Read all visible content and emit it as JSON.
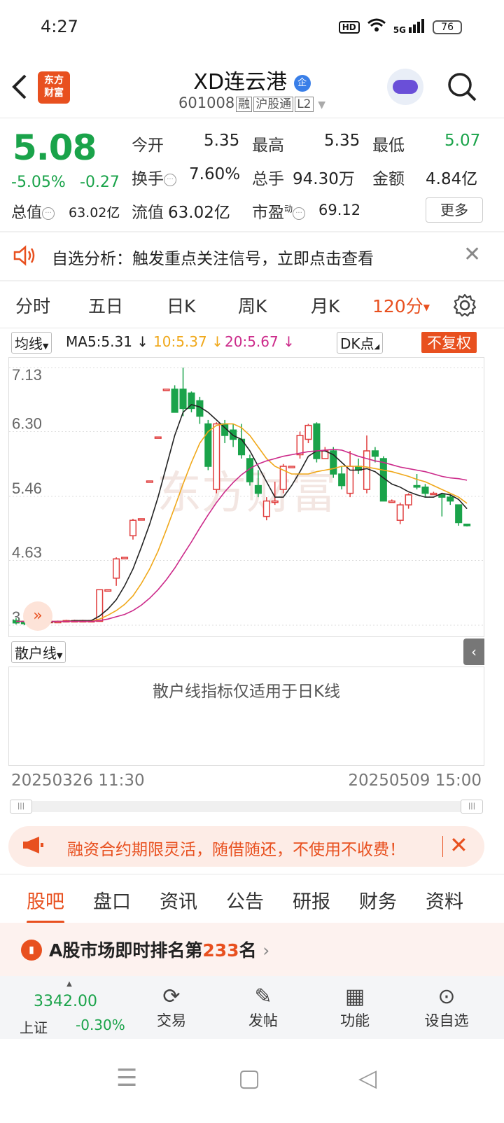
{
  "status": {
    "time": "4:27",
    "hd": "HD",
    "net": "5G",
    "battery": "76"
  },
  "header": {
    "logo_line1": "东方",
    "logo_line2": "财富",
    "stock_name": "XD连云港",
    "name_badge": "企",
    "code": "601008",
    "tags": [
      "融",
      "沪股通",
      "L2"
    ]
  },
  "quote": {
    "price": "5.08",
    "change_pct": "-5.05%",
    "change": "-0.27",
    "open_label": "今开",
    "open": "5.35",
    "high_label": "最高",
    "high": "5.35",
    "low_label": "最低",
    "low": "5.07",
    "turnover_label": "换手",
    "turnover": "7.60%",
    "volume_label": "总手",
    "volume": "94.30万",
    "amount_label": "金额",
    "amount": "4.84亿",
    "mktcap_label": "总值",
    "mktcap": "63.02亿",
    "float_label": "流值",
    "float": "63.02亿",
    "pe_label": "市盈",
    "pe_sup": "动",
    "pe": "69.12",
    "more": "更多"
  },
  "notice": {
    "text": "自选分析：触发重点关注信号，立即点击查看"
  },
  "period_tabs": [
    "分时",
    "五日",
    "日K",
    "周K",
    "月K",
    "120分"
  ],
  "indicator": {
    "ma_select": "均线",
    "ma5": "MA5:5.31",
    "ma10": "10:5.37",
    "ma20": "20:5.67",
    "dk": "DK点",
    "adjust": "不复权"
  },
  "chart_data": {
    "type": "candlestick",
    "y_ticks": [
      "7.13",
      "6.30",
      "5.46",
      "4.63",
      "3.79"
    ],
    "ylim": [
      3.79,
      7.13
    ],
    "watermark": "东方财富",
    "candles": [
      {
        "o": 3.85,
        "c": 3.82,
        "h": 3.88,
        "l": 3.8
      },
      {
        "o": 3.83,
        "c": 3.81,
        "h": 3.86,
        "l": 3.79
      },
      {
        "o": 3.8,
        "c": 3.83,
        "h": 3.85,
        "l": 3.79
      },
      {
        "o": 3.82,
        "c": 3.84,
        "h": 3.86,
        "l": 3.8
      },
      {
        "o": 3.84,
        "c": 3.84,
        "h": 3.85,
        "l": 3.83
      },
      {
        "o": 3.84,
        "c": 3.84,
        "h": 3.85,
        "l": 3.83
      },
      {
        "o": 3.84,
        "c": 3.85,
        "h": 3.86,
        "l": 3.83
      },
      {
        "o": 3.85,
        "c": 3.85,
        "h": 3.86,
        "l": 3.84
      },
      {
        "o": 3.85,
        "c": 3.85,
        "h": 3.86,
        "l": 3.84
      },
      {
        "o": 3.85,
        "c": 3.85,
        "h": 3.86,
        "l": 3.84
      },
      {
        "o": 3.84,
        "c": 4.25,
        "h": 4.25,
        "l": 3.84
      },
      {
        "o": 4.25,
        "c": 4.25,
        "h": 4.25,
        "l": 4.25
      },
      {
        "o": 4.4,
        "c": 4.65,
        "h": 4.67,
        "l": 4.3
      },
      {
        "o": 4.67,
        "c": 4.67,
        "h": 4.67,
        "l": 4.67
      },
      {
        "o": 4.95,
        "c": 5.15,
        "h": 5.17,
        "l": 4.9
      },
      {
        "o": 5.17,
        "c": 5.17,
        "h": 5.17,
        "l": 5.17
      },
      {
        "o": 5.66,
        "c": 5.66,
        "h": 5.66,
        "l": 5.66
      },
      {
        "o": 6.23,
        "c": 6.23,
        "h": 6.23,
        "l": 6.23
      },
      {
        "o": 6.85,
        "c": 6.85,
        "h": 6.85,
        "l": 6.85
      },
      {
        "o": 6.85,
        "c": 6.55,
        "h": 6.9,
        "l": 6.55
      },
      {
        "o": 6.85,
        "c": 6.6,
        "h": 7.13,
        "l": 6.5
      },
      {
        "o": 6.8,
        "c": 6.6,
        "h": 6.82,
        "l": 6.55
      },
      {
        "o": 6.7,
        "c": 6.5,
        "h": 6.75,
        "l": 6.4
      },
      {
        "o": 6.4,
        "c": 5.85,
        "h": 6.45,
        "l": 5.8
      },
      {
        "o": 5.55,
        "c": 6.4,
        "h": 6.42,
        "l": 5.5
      },
      {
        "o": 6.4,
        "c": 6.25,
        "h": 6.45,
        "l": 6.15
      },
      {
        "o": 6.32,
        "c": 6.2,
        "h": 6.4,
        "l": 6.1
      },
      {
        "o": 6.2,
        "c": 6.0,
        "h": 6.4,
        "l": 5.95
      },
      {
        "o": 5.95,
        "c": 5.65,
        "h": 6.0,
        "l": 5.6
      },
      {
        "o": 5.6,
        "c": 5.5,
        "h": 5.8,
        "l": 5.45
      },
      {
        "o": 5.2,
        "c": 5.4,
        "h": 5.45,
        "l": 5.15
      },
      {
        "o": 5.4,
        "c": 5.4,
        "h": 5.65,
        "l": 5.35
      },
      {
        "o": 5.55,
        "c": 5.85,
        "h": 5.88,
        "l": 5.5
      },
      {
        "o": 5.85,
        "c": 5.85,
        "h": 5.85,
        "l": 5.85
      },
      {
        "o": 6.0,
        "c": 6.25,
        "h": 6.3,
        "l": 5.95
      },
      {
        "o": 6.2,
        "c": 6.38,
        "h": 6.4,
        "l": 6.15
      },
      {
        "o": 6.4,
        "c": 5.95,
        "h": 6.42,
        "l": 5.9
      },
      {
        "o": 5.95,
        "c": 6.05,
        "h": 6.1,
        "l": 5.95
      },
      {
        "o": 6.05,
        "c": 5.75,
        "h": 6.1,
        "l": 5.7
      },
      {
        "o": 5.75,
        "c": 5.6,
        "h": 5.85,
        "l": 5.55
      },
      {
        "o": 5.5,
        "c": 5.85,
        "h": 6.05,
        "l": 5.45
      },
      {
        "o": 5.85,
        "c": 5.8,
        "h": 5.95,
        "l": 5.75
      },
      {
        "o": 5.55,
        "c": 6.05,
        "h": 6.25,
        "l": 5.5
      },
      {
        "o": 6.05,
        "c": 5.98,
        "h": 6.1,
        "l": 5.9
      },
      {
        "o": 5.95,
        "c": 5.4,
        "h": 5.98,
        "l": 5.4
      },
      {
        "o": 5.4,
        "c": 5.4,
        "h": 5.42,
        "l": 5.38
      },
      {
        "o": 5.15,
        "c": 5.35,
        "h": 5.38,
        "l": 5.1
      },
      {
        "o": 5.35,
        "c": 5.48,
        "h": 5.5,
        "l": 5.3
      },
      {
        "o": 5.6,
        "c": 5.58,
        "h": 5.75,
        "l": 5.55
      },
      {
        "o": 5.58,
        "c": 5.5,
        "h": 5.62,
        "l": 5.45
      },
      {
        "o": 5.5,
        "c": 5.5,
        "h": 5.52,
        "l": 5.48
      },
      {
        "o": 5.48,
        "c": 5.45,
        "h": 5.5,
        "l": 5.2
      },
      {
        "o": 5.45,
        "c": 5.4,
        "h": 5.48,
        "l": 5.35
      },
      {
        "o": 5.35,
        "c": 5.12,
        "h": 5.35,
        "l": 5.08
      },
      {
        "o": 5.1,
        "c": 5.08,
        "h": 5.1,
        "l": 5.07
      }
    ],
    "ma5": [
      3.84,
      3.84,
      3.83,
      3.83,
      3.83,
      3.84,
      3.84,
      3.85,
      3.85,
      3.85,
      3.91,
      4.0,
      4.12,
      4.3,
      4.52,
      4.8,
      5.1,
      5.45,
      5.85,
      6.25,
      6.55,
      6.65,
      6.62,
      6.55,
      6.45,
      6.35,
      6.25,
      6.2,
      6.05,
      5.85,
      5.65,
      5.45,
      5.45,
      5.6,
      5.78,
      5.98,
      6.05,
      6.05,
      6.0,
      5.9,
      5.8,
      5.8,
      5.82,
      5.78,
      5.7,
      5.62,
      5.58,
      5.52,
      5.48,
      5.45,
      5.45,
      5.5,
      5.48,
      5.42,
      5.3
    ],
    "ma10": [
      3.84,
      3.84,
      3.84,
      3.84,
      3.84,
      3.84,
      3.84,
      3.84,
      3.84,
      3.84,
      3.87,
      3.92,
      3.98,
      4.06,
      4.17,
      4.33,
      4.52,
      4.75,
      5.03,
      5.32,
      5.62,
      5.9,
      6.15,
      6.3,
      6.38,
      6.4,
      6.4,
      6.35,
      6.25,
      6.1,
      5.95,
      5.85,
      5.8,
      5.75,
      5.75,
      5.75,
      5.78,
      5.8,
      5.82,
      5.85,
      5.85,
      5.85,
      5.84,
      5.82,
      5.8,
      5.78,
      5.75,
      5.72,
      5.68,
      5.65,
      5.6,
      5.55,
      5.5,
      5.45,
      5.37
    ],
    "ma20": [
      3.84,
      3.84,
      3.84,
      3.84,
      3.84,
      3.84,
      3.84,
      3.84,
      3.84,
      3.84,
      3.85,
      3.87,
      3.9,
      3.93,
      3.98,
      4.05,
      4.14,
      4.25,
      4.38,
      4.53,
      4.7,
      4.87,
      5.05,
      5.22,
      5.38,
      5.52,
      5.64,
      5.74,
      5.82,
      5.88,
      5.92,
      5.95,
      5.98,
      6.0,
      6.02,
      6.04,
      6.05,
      6.06,
      6.07,
      6.06,
      6.02,
      5.98,
      5.95,
      5.92,
      5.9,
      5.87,
      5.84,
      5.82,
      5.8,
      5.78,
      5.75,
      5.72,
      5.7,
      5.69,
      5.67
    ]
  },
  "sanhu": {
    "select": "散户线",
    "message": "散户线指标仅适用于日K线"
  },
  "date_range": {
    "start": "20250326 11:30",
    "end": "20250509 15:00"
  },
  "promo": {
    "text": "融资合约期限灵活，随借随还，不使用不收费！"
  },
  "bottom_tabs": [
    "股吧",
    "盘口",
    "资讯",
    "公告",
    "研报",
    "财务",
    "资料"
  ],
  "rank": {
    "prefix": "A股市场即时排名第",
    "number": "233",
    "suffix": "名"
  },
  "toolbar": {
    "index_value": "3342.00",
    "index_name": "上证",
    "index_change": "-0.30%",
    "trade": "交易",
    "post": "发帖",
    "func": "功能",
    "watch": "设自选"
  },
  "colors": {
    "up": "#e03c3c",
    "down": "#1aa34a",
    "accent": "#e8501f",
    "ma5": "#222222",
    "ma10": "#f0a81a",
    "ma20": "#cc2a8a"
  }
}
